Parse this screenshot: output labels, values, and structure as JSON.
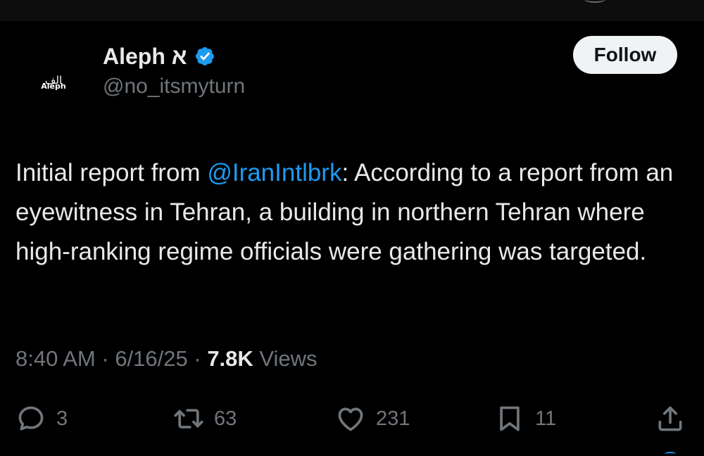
{
  "author": {
    "avatar_arabic": "الف",
    "avatar_latin": "Aleph",
    "display_name": "Aleph א",
    "handle": "@no_itsmyturn",
    "verified": true
  },
  "follow_label": "Follow",
  "tweet": {
    "text_before": "Initial report from ",
    "mention": "@IranIntlbrk",
    "text_after": ": According to a report from an eyewitness in Tehran, a building in northern Tehran where high-ranking regime officials were gathering was targeted."
  },
  "meta": {
    "time": "8:40 AM",
    "separator": " · ",
    "date": "6/16/25",
    "views_count": "7.8K",
    "views_label": " Views"
  },
  "actions": {
    "replies": "3",
    "reposts": "63",
    "likes": "231",
    "bookmarks": "11"
  },
  "colors": {
    "background": "#000000",
    "text": "#e7e9ea",
    "secondary": "#71767b",
    "accent": "#1d9bf0",
    "follow_bg": "#eff3f4"
  }
}
